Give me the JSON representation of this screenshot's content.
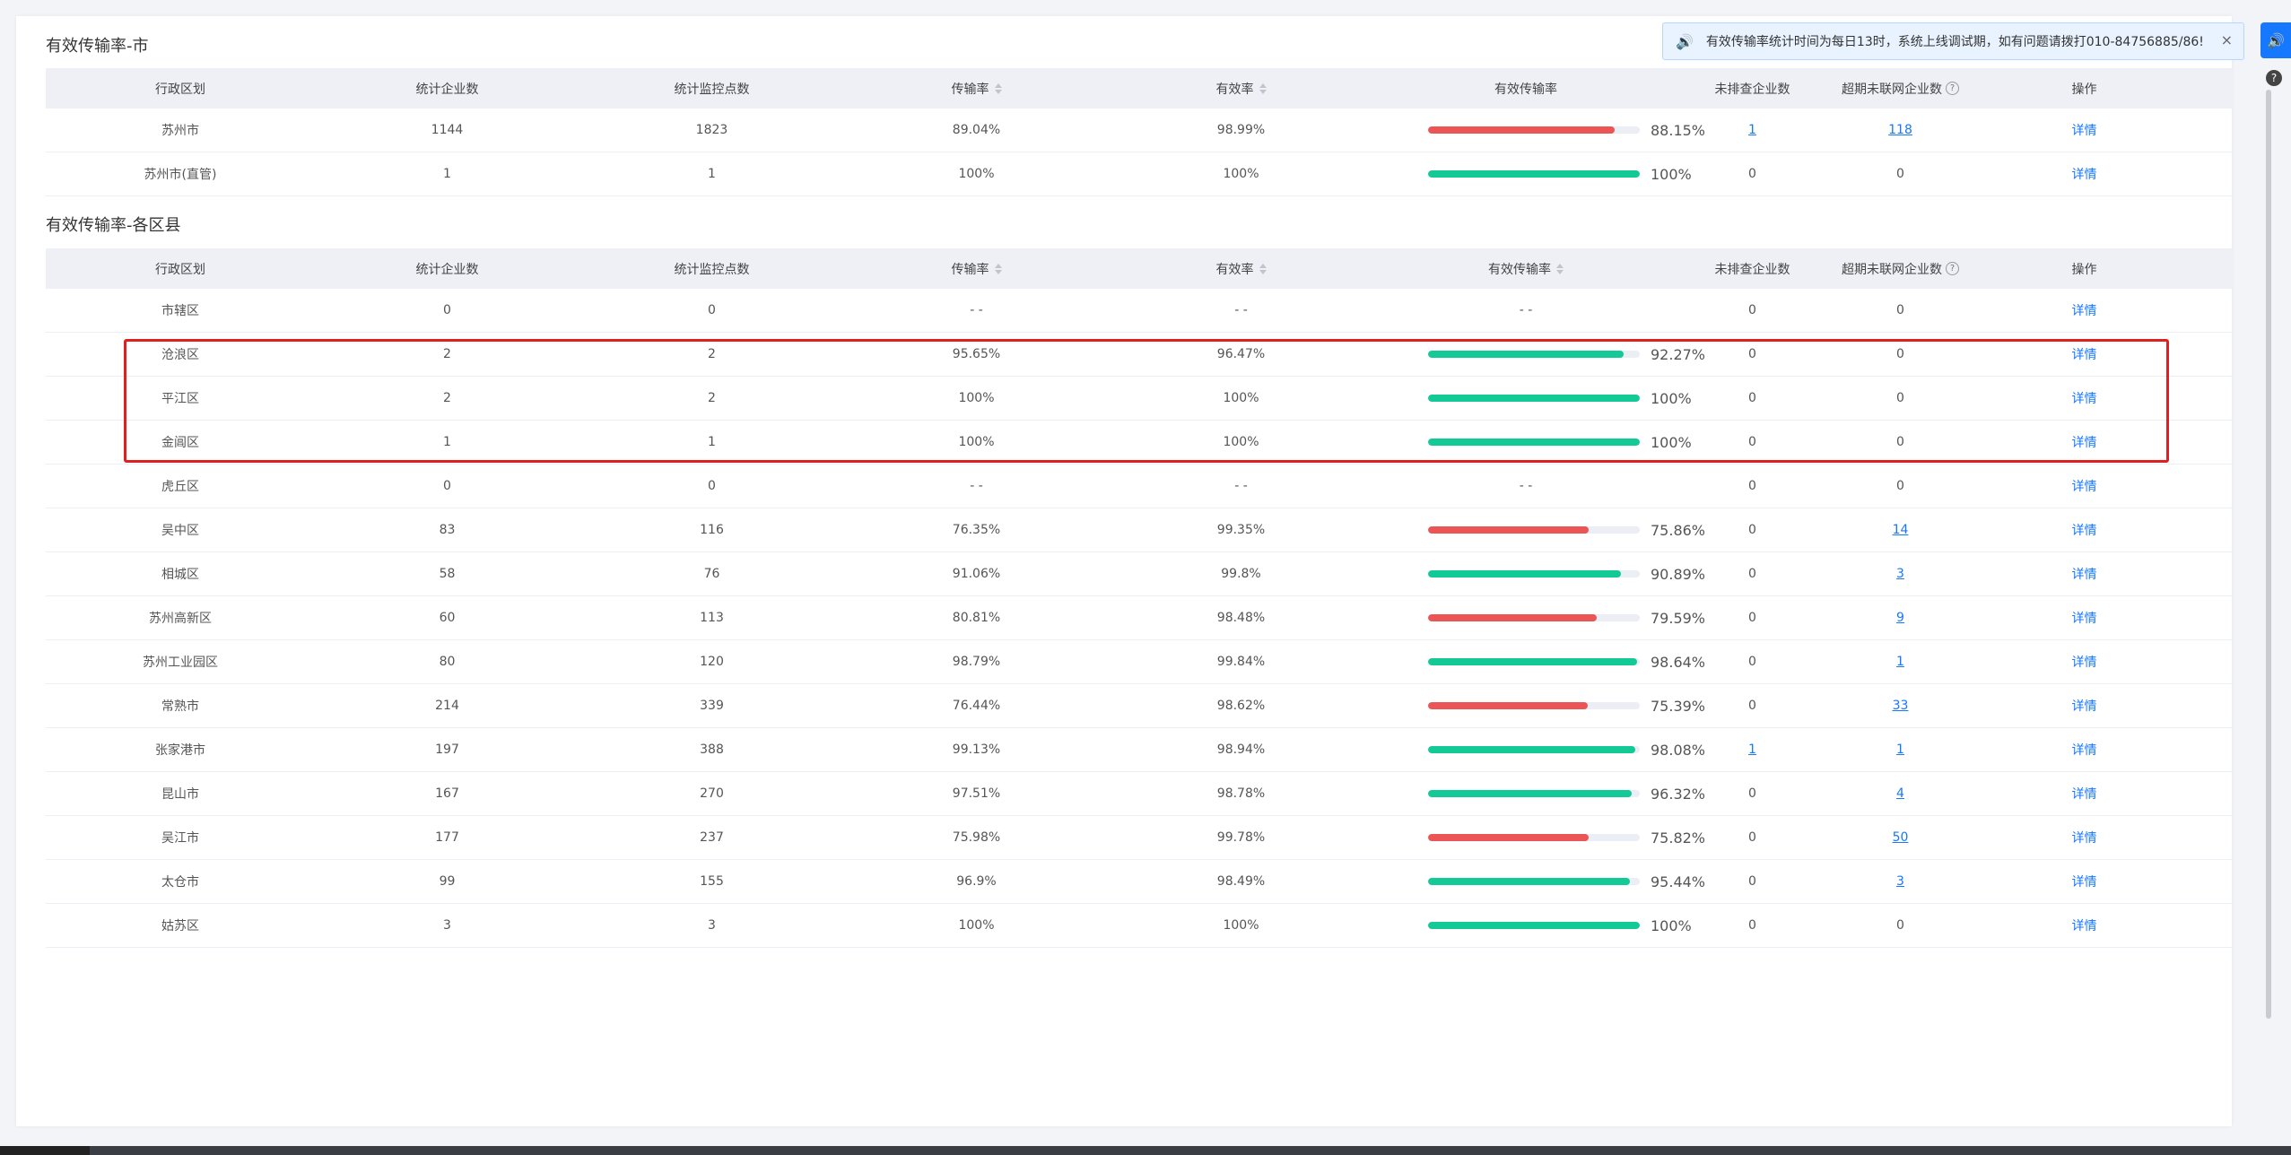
{
  "notice": {
    "text": "有效传输率统计时间为每日13时，系统上线调试期，如有问题请拨打010-84756885/86!",
    "close": "×"
  },
  "side": {
    "help": "?"
  },
  "city_section": {
    "title": "有效传输率-市",
    "headers": [
      "行政区划",
      "统计企业数",
      "统计监控点数",
      "传输率",
      "有效率",
      "有效传输率",
      "未排查企业数",
      "超期未联网企业数",
      "操作"
    ],
    "rows": [
      {
        "region": "苏州市",
        "companies": "1144",
        "points": "1823",
        "trans": "89.04%",
        "valid": "98.99%",
        "eff_text": "88.15%",
        "eff": 88.15,
        "eff_color": "red",
        "unchecked": "1",
        "unchecked_link": true,
        "overdue": "118",
        "overdue_link": true,
        "op": "详情"
      },
      {
        "region": "苏州市(直管)",
        "companies": "1",
        "points": "1",
        "trans": "100%",
        "valid": "100%",
        "eff_text": "100%",
        "eff": 100,
        "eff_color": "green",
        "unchecked": "0",
        "unchecked_link": false,
        "overdue": "0",
        "overdue_link": false,
        "op": "详情"
      }
    ]
  },
  "district_section": {
    "title": "有效传输率-各区县",
    "headers": [
      "行政区划",
      "统计企业数",
      "统计监控点数",
      "传输率",
      "有效率",
      "有效传输率",
      "未排查企业数",
      "超期未联网企业数",
      "操作"
    ],
    "rows": [
      {
        "region": "市辖区",
        "companies": "0",
        "points": "0",
        "trans": "- -",
        "valid": "- -",
        "eff_text": "- -",
        "eff": null,
        "eff_color": "",
        "unchecked": "0",
        "unchecked_link": false,
        "overdue": "0",
        "overdue_link": false,
        "op": "详情"
      },
      {
        "region": "沧浪区",
        "companies": "2",
        "points": "2",
        "trans": "95.65%",
        "valid": "96.47%",
        "eff_text": "92.27%",
        "eff": 92.27,
        "eff_color": "green",
        "unchecked": "0",
        "unchecked_link": false,
        "overdue": "0",
        "overdue_link": false,
        "op": "详情"
      },
      {
        "region": "平江区",
        "companies": "2",
        "points": "2",
        "trans": "100%",
        "valid": "100%",
        "eff_text": "100%",
        "eff": 100,
        "eff_color": "green",
        "unchecked": "0",
        "unchecked_link": false,
        "overdue": "0",
        "overdue_link": false,
        "op": "详情"
      },
      {
        "region": "金阊区",
        "companies": "1",
        "points": "1",
        "trans": "100%",
        "valid": "100%",
        "eff_text": "100%",
        "eff": 100,
        "eff_color": "green",
        "unchecked": "0",
        "unchecked_link": false,
        "overdue": "0",
        "overdue_link": false,
        "op": "详情"
      },
      {
        "region": "虎丘区",
        "companies": "0",
        "points": "0",
        "trans": "- -",
        "valid": "- -",
        "eff_text": "- -",
        "eff": null,
        "eff_color": "",
        "unchecked": "0",
        "unchecked_link": false,
        "overdue": "0",
        "overdue_link": false,
        "op": "详情"
      },
      {
        "region": "吴中区",
        "companies": "83",
        "points": "116",
        "trans": "76.35%",
        "valid": "99.35%",
        "eff_text": "75.86%",
        "eff": 75.86,
        "eff_color": "red",
        "unchecked": "0",
        "unchecked_link": false,
        "overdue": "14",
        "overdue_link": true,
        "op": "详情"
      },
      {
        "region": "相城区",
        "companies": "58",
        "points": "76",
        "trans": "91.06%",
        "valid": "99.8%",
        "eff_text": "90.89%",
        "eff": 90.89,
        "eff_color": "green",
        "unchecked": "0",
        "unchecked_link": false,
        "overdue": "3",
        "overdue_link": true,
        "op": "详情"
      },
      {
        "region": "苏州高新区",
        "companies": "60",
        "points": "113",
        "trans": "80.81%",
        "valid": "98.48%",
        "eff_text": "79.59%",
        "eff": 79.59,
        "eff_color": "red",
        "unchecked": "0",
        "unchecked_link": false,
        "overdue": "9",
        "overdue_link": true,
        "op": "详情"
      },
      {
        "region": "苏州工业园区",
        "companies": "80",
        "points": "120",
        "trans": "98.79%",
        "valid": "99.84%",
        "eff_text": "98.64%",
        "eff": 98.64,
        "eff_color": "green",
        "unchecked": "0",
        "unchecked_link": false,
        "overdue": "1",
        "overdue_link": true,
        "op": "详情"
      },
      {
        "region": "常熟市",
        "companies": "214",
        "points": "339",
        "trans": "76.44%",
        "valid": "98.62%",
        "eff_text": "75.39%",
        "eff": 75.39,
        "eff_color": "red",
        "unchecked": "0",
        "unchecked_link": false,
        "overdue": "33",
        "overdue_link": true,
        "op": "详情"
      },
      {
        "region": "张家港市",
        "companies": "197",
        "points": "388",
        "trans": "99.13%",
        "valid": "98.94%",
        "eff_text": "98.08%",
        "eff": 98.08,
        "eff_color": "green",
        "unchecked": "1",
        "unchecked_link": true,
        "overdue": "1",
        "overdue_link": true,
        "op": "详情"
      },
      {
        "region": "昆山市",
        "companies": "167",
        "points": "270",
        "trans": "97.51%",
        "valid": "98.78%",
        "eff_text": "96.32%",
        "eff": 96.32,
        "eff_color": "green",
        "unchecked": "0",
        "unchecked_link": false,
        "overdue": "4",
        "overdue_link": true,
        "op": "详情"
      },
      {
        "region": "吴江市",
        "companies": "177",
        "points": "237",
        "trans": "75.98%",
        "valid": "99.78%",
        "eff_text": "75.82%",
        "eff": 75.82,
        "eff_color": "red",
        "unchecked": "0",
        "unchecked_link": false,
        "overdue": "50",
        "overdue_link": true,
        "op": "详情"
      },
      {
        "region": "太仓市",
        "companies": "99",
        "points": "155",
        "trans": "96.9%",
        "valid": "98.49%",
        "eff_text": "95.44%",
        "eff": 95.44,
        "eff_color": "green",
        "unchecked": "0",
        "unchecked_link": false,
        "overdue": "3",
        "overdue_link": true,
        "op": "详情"
      },
      {
        "region": "姑苏区",
        "companies": "3",
        "points": "3",
        "trans": "100%",
        "valid": "100%",
        "eff_text": "100%",
        "eff": 100,
        "eff_color": "green",
        "unchecked": "0",
        "unchecked_link": false,
        "overdue": "0",
        "overdue_link": false,
        "op": "详情"
      }
    ]
  },
  "colors": {
    "green": "#13c995",
    "red": "#eb5555",
    "link": "#1677ff",
    "highlight": "#e02020"
  }
}
